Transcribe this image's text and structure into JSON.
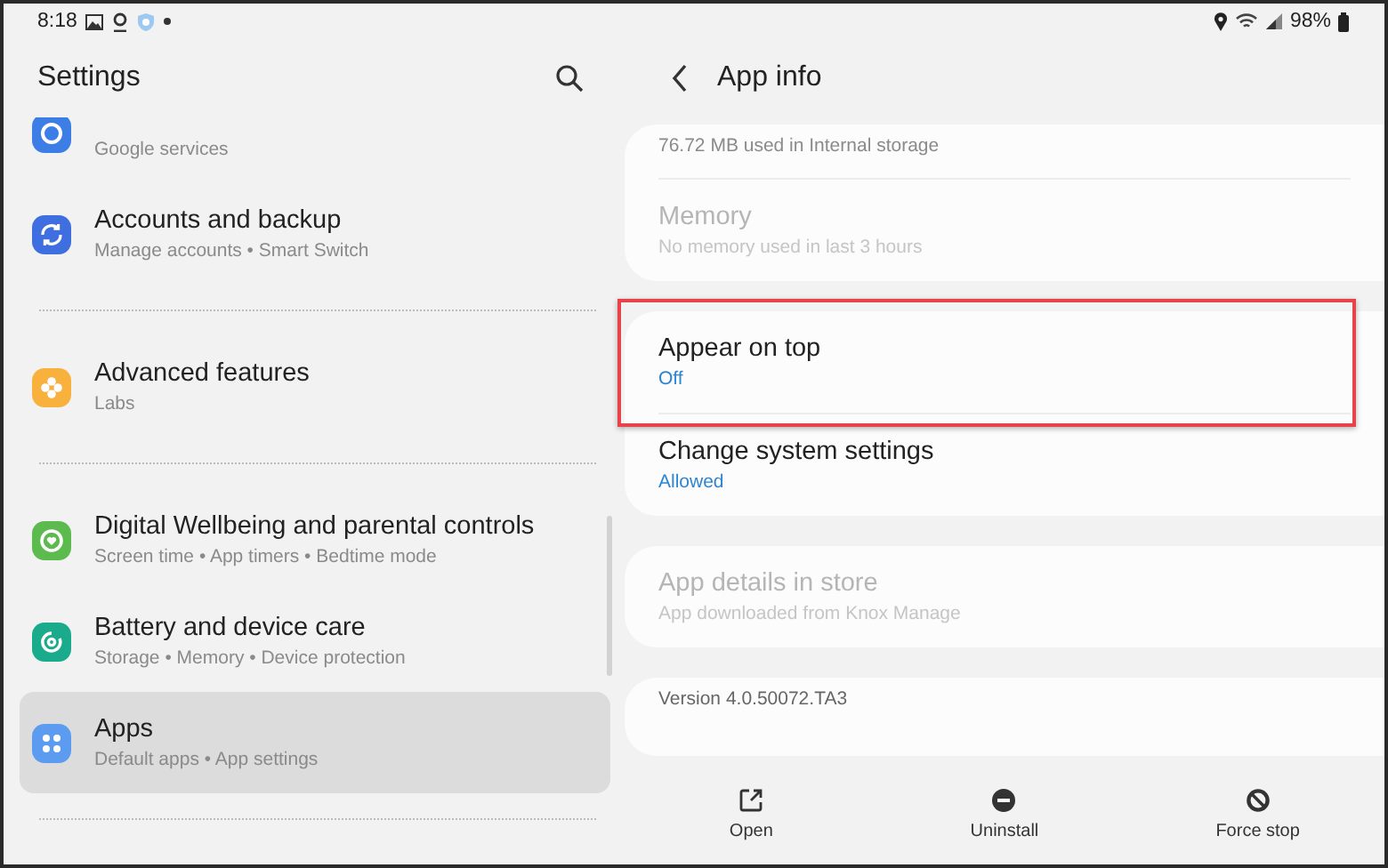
{
  "status_bar": {
    "time": "8:18",
    "battery": "98%"
  },
  "settings": {
    "title": "Settings",
    "groups": [
      {
        "items": [
          {
            "subtitle": "Google services",
            "color": "#3d7ee6",
            "selected": false
          },
          {
            "title": "Accounts and backup",
            "subtitle": "Manage accounts • Smart Switch",
            "color": "#3f6ee0",
            "selected": false
          }
        ]
      },
      {
        "items": [
          {
            "title": "Advanced features",
            "subtitle": "Labs",
            "color": "#f8b13c",
            "selected": false
          }
        ]
      },
      {
        "items": [
          {
            "title": "Digital Wellbeing and parental controls",
            "subtitle": "Screen time • App timers • Bedtime mode",
            "color": "#5cba4e",
            "selected": false
          },
          {
            "title": "Battery and device care",
            "subtitle": "Storage • Memory • Device protection",
            "color": "#1aaa8c",
            "selected": false
          },
          {
            "title": "Apps",
            "subtitle": "Default apps • App settings",
            "color": "#5b9cf0",
            "selected": true
          }
        ]
      }
    ]
  },
  "app_info": {
    "title": "App info",
    "cards": [
      {
        "items": [
          {
            "kind": "info",
            "subtitle": "76.72 MB used in Internal storage",
            "disabled": false,
            "highlighted": false
          },
          {
            "kind": "info",
            "title": "Memory",
            "subtitle": "No memory used in last 3 hours",
            "disabled": true,
            "highlighted": false
          }
        ]
      },
      {
        "items": [
          {
            "kind": "setting",
            "title": "Appear on top",
            "subtitle": "Off",
            "disabled": false,
            "highlighted": true
          },
          {
            "kind": "setting",
            "title": "Change system settings",
            "subtitle": "Allowed",
            "disabled": false,
            "highlighted": false
          }
        ]
      },
      {
        "items": [
          {
            "kind": "info",
            "title": "App details in store",
            "subtitle": "App downloaded from Knox Manage",
            "disabled": true,
            "highlighted": false
          }
        ]
      },
      {
        "items": [
          {
            "kind": "version",
            "subtitle": "Version 4.0.50072.TA3",
            "disabled": false,
            "highlighted": false
          }
        ]
      }
    ],
    "actions": [
      {
        "label": "Open"
      },
      {
        "label": "Uninstall"
      },
      {
        "label": "Force stop"
      }
    ]
  }
}
